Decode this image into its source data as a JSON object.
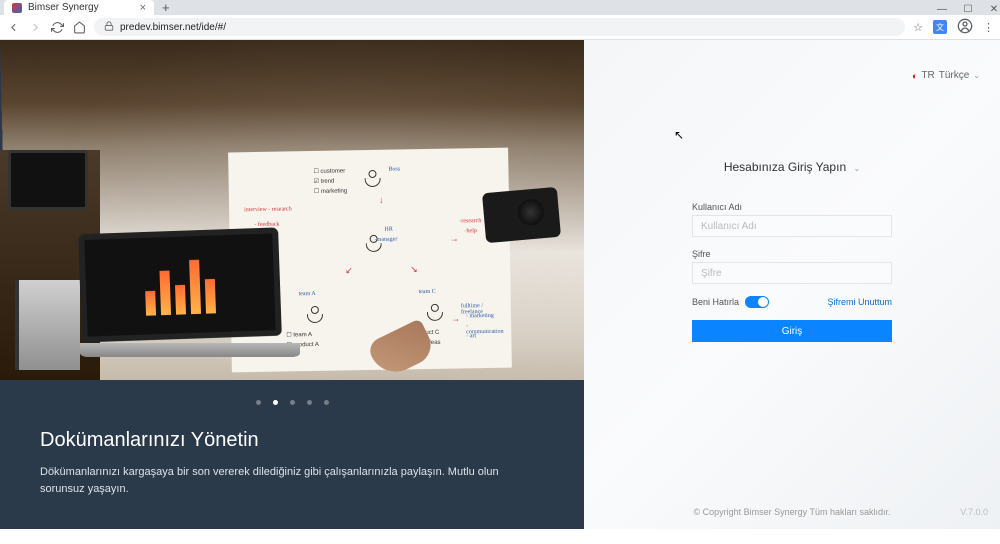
{
  "browser": {
    "tab_title": "Bimser Synergy",
    "url": "predev.bimser.net/ide/#/"
  },
  "lang": {
    "code": "TR",
    "label": "Türkçe"
  },
  "hero": {
    "title": "Dokümanlarınızı Yönetin",
    "description": "Dökümanlarınızı kargaşaya bir son vererek dilediğiniz gibi çalışanlarınızla paylaşın. Mutlu olun sorunsuz yaşayın.",
    "active_dot_index": 1,
    "dot_count": 5
  },
  "login": {
    "title": "Hesabınıza Giriş Yapın",
    "username_label": "Kullanıcı Adı",
    "username_placeholder": "Kullanıcı Adı",
    "password_label": "Şifre",
    "password_placeholder": "Şifre",
    "remember_label": "Beni Hatırla",
    "remember_on": true,
    "forgot_label": "Şifremi Unuttum",
    "submit_label": "Giriş"
  },
  "footer": {
    "copyright": "© Copyright Bimser Synergy Tüm hakları saklıdır.",
    "version": "V.7.0.0"
  }
}
